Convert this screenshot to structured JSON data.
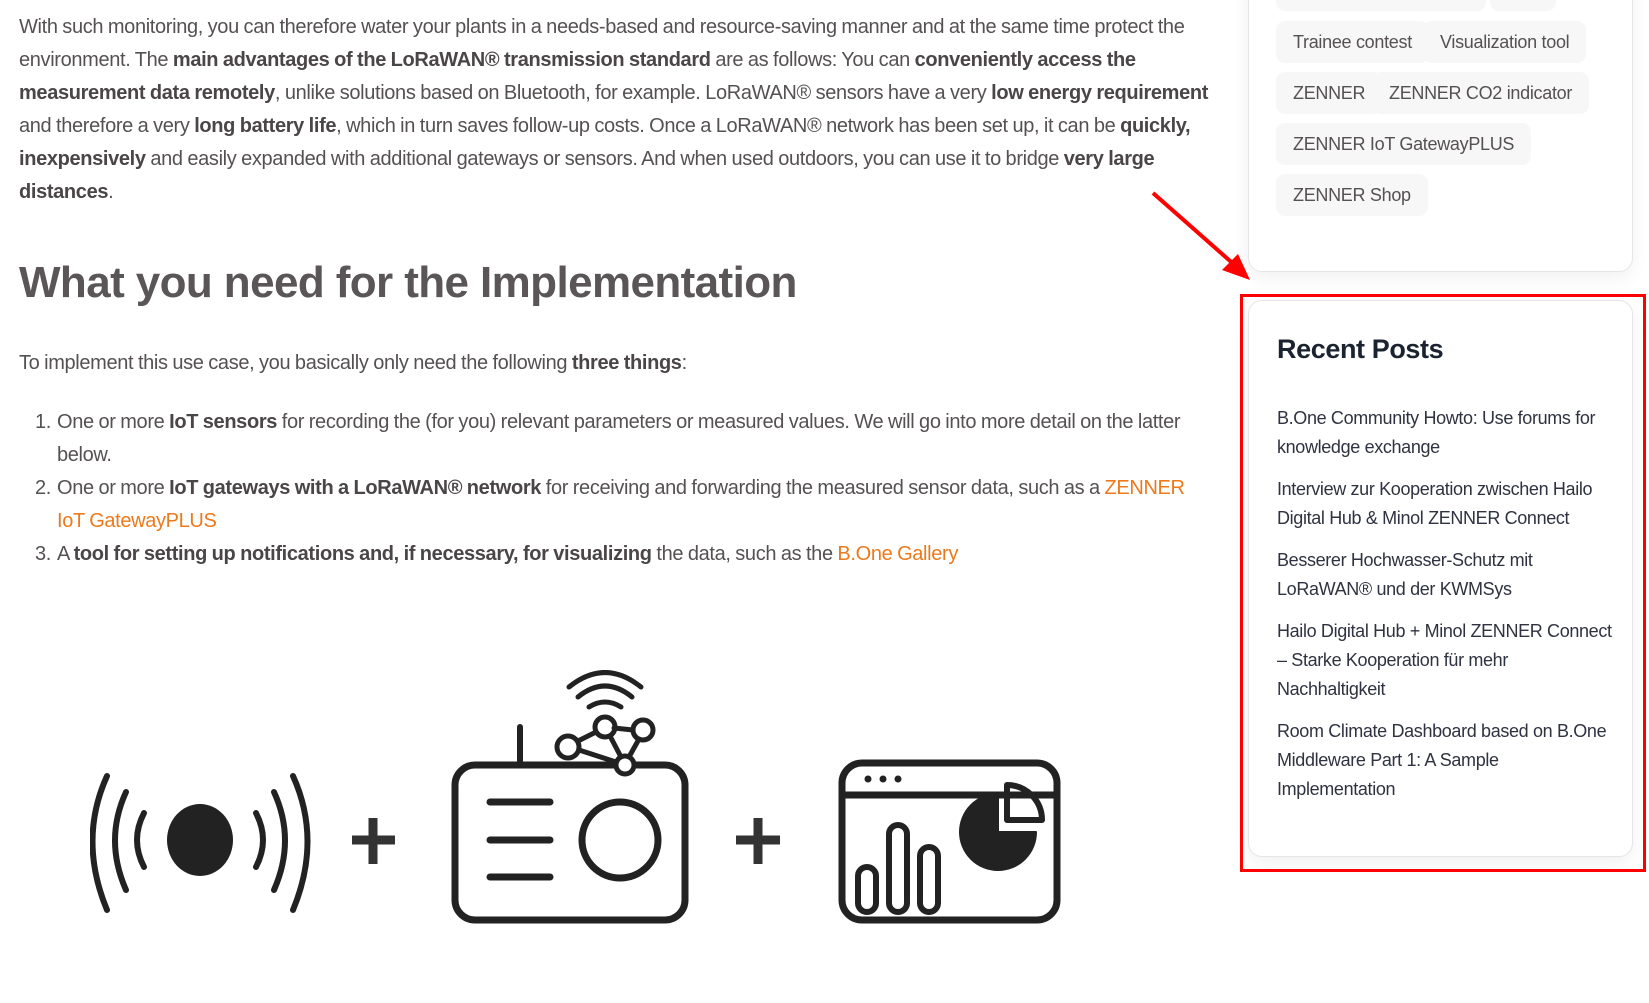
{
  "article": {
    "paragraph": [
      {
        "t": "With such monitoring, you can therefore water your plants in a needs-based and resource-saving manner and at the same time protect the environment. The ",
        "b": false
      },
      {
        "t": "main advantages of the LoRaWAN® transmission standard",
        "b": true
      },
      {
        "t": " are as follows: You can ",
        "b": false
      },
      {
        "t": "conveniently access the measurement data remotely",
        "b": true
      },
      {
        "t": ", unlike solutions based on Bluetooth, for example. LoRaWAN® sensors have a very ",
        "b": false
      },
      {
        "t": "low energy requirement",
        "b": true
      },
      {
        "t": " and therefore a very ",
        "b": false
      },
      {
        "t": "long battery life",
        "b": true
      },
      {
        "t": ", which in turn saves follow-up costs. Once a LoRaWAN® network has been set up, it can be ",
        "b": false
      },
      {
        "t": "quickly, inexpensively",
        "b": true
      },
      {
        "t": " and easily expanded with additional gateways or sensors. And when used outdoors, you can use it to bridge ",
        "b": false
      },
      {
        "t": "very large distances",
        "b": true
      },
      {
        "t": ".",
        "b": false
      }
    ],
    "heading": "What you need for the Implementation",
    "intro": {
      "before": "To implement this use case, you basically only need the following ",
      "bold": "three things",
      "after": ":"
    },
    "requirements": [
      {
        "number": "1.",
        "pre": "One or more ",
        "bold": "IoT sensors",
        "post": " for recording the (for you) relevant parameters or measured values. We will go into more detail on the latter below.",
        "link": ""
      },
      {
        "number": "2.",
        "pre": "One or more ",
        "bold": "IoT gateways with a LoRaWAN® network",
        "post": " for receiving and forwarding the measured sensor data, such as a ",
        "link": "ZENNER IoT GatewayPLUS"
      },
      {
        "number": "3.",
        "pre": "A ",
        "bold": "tool for setting up notifications and, if necessary, for visualizing",
        "post": " the data, such as the ",
        "link": "B.One Gallery"
      }
    ],
    "illustration": {
      "items": [
        "sensor-icon",
        "plus-icon",
        "gateway-icon",
        "plus-icon",
        "dashboard-icon"
      ]
    },
    "link_color": "#ec7a1c"
  },
  "sidebar": {
    "tags": [
      "",
      "",
      "Trainee contest",
      "Visualization tool",
      "ZENNER",
      "ZENNER CO2 indicator",
      "ZENNER IoT GatewayPLUS",
      "ZENNER Shop"
    ],
    "recent_posts": {
      "title": "Recent Posts",
      "items": [
        "B.One Community Howto: Use forums for knowledge exchange",
        "Interview zur Kooperation zwischen Hailo Digital Hub & Minol ZENNER Connect",
        "Besserer Hochwasser-Schutz mit LoRaWAN® und der KWMSys",
        "Hailo Digital Hub + Minol ZENNER Connect – Starke Kooperation für mehr Nachhaltigkeit",
        "Room Climate Dashboard based on B.One Middleware Part 1: A Sample Implementation"
      ]
    }
  },
  "annotation": {
    "highlight_color": "#ff0000"
  }
}
